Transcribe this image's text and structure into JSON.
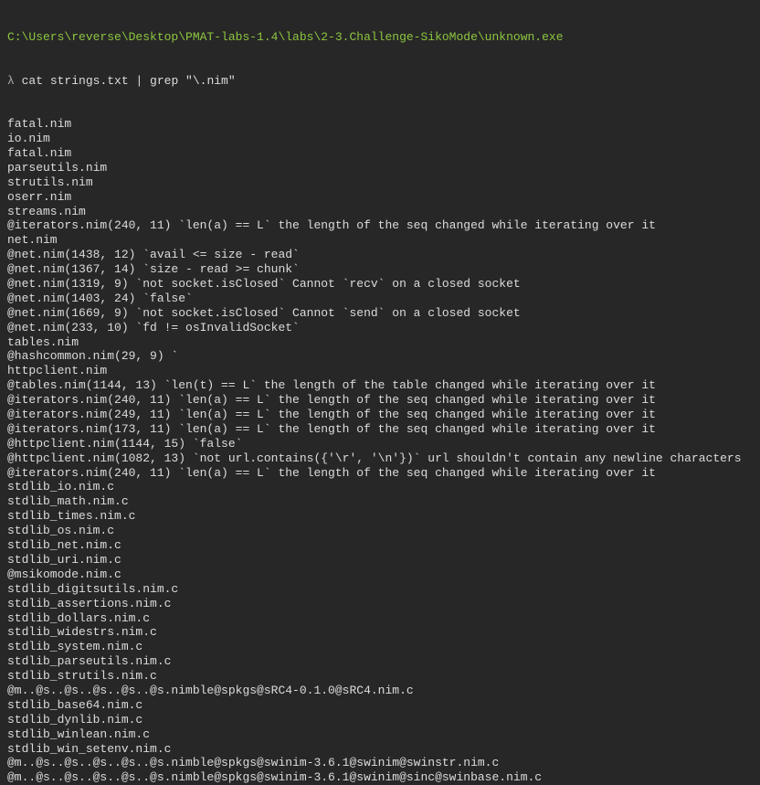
{
  "terminal": {
    "cwd": "C:\\Users\\reverse\\Desktop\\PMAT-labs-1.4\\labs\\2-3.Challenge-SikoMode\\unknown.exe",
    "prompt_symbol": "λ",
    "command": "cat strings.txt | grep \"\\.nim\"",
    "output": [
      "fatal.nim",
      "io.nim",
      "fatal.nim",
      "parseutils.nim",
      "strutils.nim",
      "oserr.nim",
      "streams.nim",
      "@iterators.nim(240, 11) `len(a) == L` the length of the seq changed while iterating over it",
      "net.nim",
      "@net.nim(1438, 12) `avail <= size - read`",
      "@net.nim(1367, 14) `size - read >= chunk`",
      "@net.nim(1319, 9) `not socket.isClosed` Cannot `recv` on a closed socket",
      "@net.nim(1403, 24) `false`",
      "@net.nim(1669, 9) `not socket.isClosed` Cannot `send` on a closed socket",
      "@net.nim(233, 10) `fd != osInvalidSocket`",
      "tables.nim",
      "@hashcommon.nim(29, 9) `",
      "httpclient.nim",
      "@tables.nim(1144, 13) `len(t) == L` the length of the table changed while iterating over it",
      "@iterators.nim(240, 11) `len(a) == L` the length of the seq changed while iterating over it",
      "@iterators.nim(249, 11) `len(a) == L` the length of the seq changed while iterating over it",
      "@iterators.nim(173, 11) `len(a) == L` the length of the seq changed while iterating over it",
      "@httpclient.nim(1144, 15) `false`",
      "@httpclient.nim(1082, 13) `not url.contains({'\\r', '\\n'})` url shouldn't contain any newline characters",
      "@iterators.nim(240, 11) `len(a) == L` the length of the seq changed while iterating over it",
      "stdlib_io.nim.c",
      "stdlib_math.nim.c",
      "stdlib_times.nim.c",
      "stdlib_os.nim.c",
      "stdlib_net.nim.c",
      "stdlib_uri.nim.c",
      "@msikomode.nim.c",
      "stdlib_digitsutils.nim.c",
      "stdlib_assertions.nim.c",
      "stdlib_dollars.nim.c",
      "stdlib_widestrs.nim.c",
      "stdlib_system.nim.c",
      "stdlib_parseutils.nim.c",
      "stdlib_strutils.nim.c",
      "@m..@s..@s..@s..@s..@s.nimble@spkgs@sRC4-0.1.0@sRC4.nim.c",
      "stdlib_base64.nim.c",
      "stdlib_dynlib.nim.c",
      "stdlib_winlean.nim.c",
      "stdlib_win_setenv.nim.c",
      "@m..@s..@s..@s..@s..@s.nimble@spkgs@swinim-3.6.1@swinim@swinstr.nim.c",
      "@m..@s..@s..@s..@s..@s.nimble@spkgs@swinim-3.6.1@swinim@sinc@swinbase.nim.c"
    ]
  },
  "colors": {
    "background": "#272727",
    "text": "#dcdcdc",
    "path": "#8dc63f",
    "prompt": "#a8a8a8"
  }
}
